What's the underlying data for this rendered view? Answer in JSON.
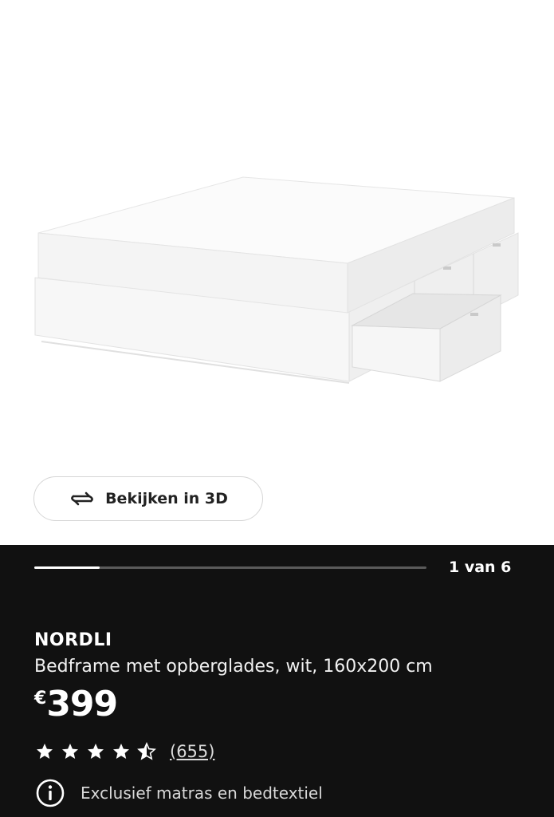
{
  "product": {
    "brand": "NORDLI",
    "description": "Bedframe met opberglades, wit, 160x200 cm",
    "currency": "€",
    "price": "399",
    "rating": 4.5,
    "rating_max": 5,
    "review_count": "(655)",
    "note": "Exclusief matras en bedtextiel"
  },
  "gallery": {
    "view_3d_label": "Bekijken in 3D",
    "page_counter": "1 van 6",
    "progress": 0.167
  },
  "icons": {
    "rotate": "rotate-3d-icon",
    "star": "star-icon",
    "info": "info-icon"
  },
  "colors": {
    "panel_bg": "#111111",
    "text": "#ffffff",
    "track": "#5a5a5a"
  }
}
